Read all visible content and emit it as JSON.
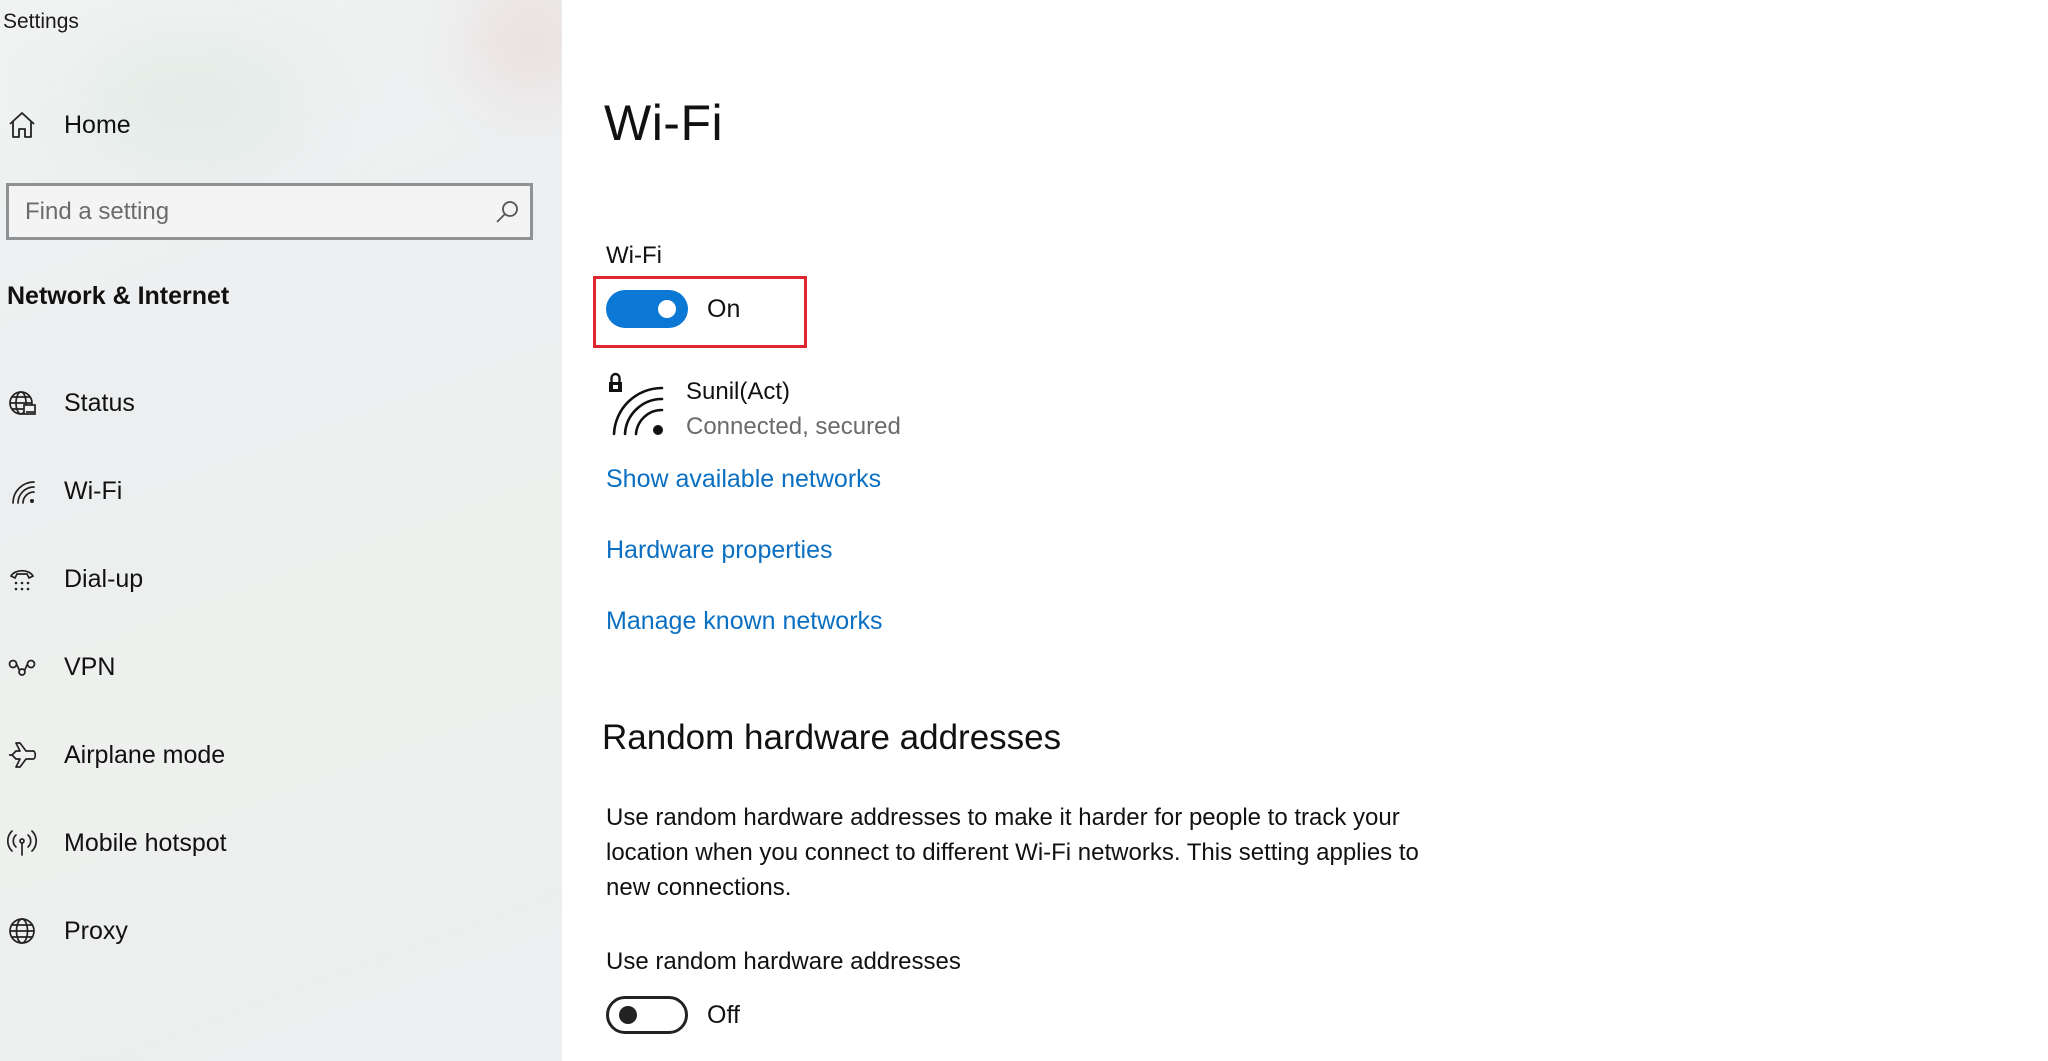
{
  "app": {
    "title": "Settings"
  },
  "sidebar": {
    "home_label": "Home",
    "search": {
      "placeholder": "Find a setting",
      "value": ""
    },
    "section_title": "Network & Internet",
    "items": [
      {
        "label": "Status",
        "icon": "globe-status-icon"
      },
      {
        "label": "Wi-Fi",
        "icon": "wifi-icon"
      },
      {
        "label": "Dial-up",
        "icon": "dialup-icon"
      },
      {
        "label": "VPN",
        "icon": "vpn-icon"
      },
      {
        "label": "Airplane mode",
        "icon": "airplane-icon"
      },
      {
        "label": "Mobile hotspot",
        "icon": "hotspot-icon"
      },
      {
        "label": "Proxy",
        "icon": "globe-icon"
      }
    ]
  },
  "main": {
    "title": "Wi-Fi",
    "wifi_toggle": {
      "caption": "Wi-Fi",
      "state": "On",
      "on": true
    },
    "network": {
      "name": "Sunil(Act)",
      "status": "Connected, secured"
    },
    "links": {
      "show_networks": "Show available networks",
      "hardware_properties": "Hardware properties",
      "manage_networks": "Manage known networks"
    },
    "random_hw": {
      "heading": "Random hardware addresses",
      "description": "Use random hardware addresses to make it harder for people to track your location when you connect to different Wi-Fi networks. This setting applies to new connections.",
      "toggle_caption": "Use random hardware addresses",
      "state": "Off",
      "on": false
    }
  },
  "colors": {
    "accent": "#0a78d4",
    "link": "#0b6fc2",
    "highlight": "#e0282e",
    "secondary_text": "#6b6b6b"
  }
}
